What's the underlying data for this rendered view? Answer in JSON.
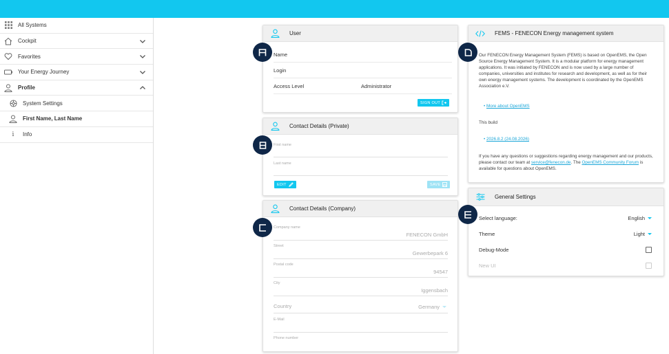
{
  "sidebar": {
    "items": [
      {
        "label": "All Systems",
        "icon": "grid-icon"
      },
      {
        "label": "Cockpit",
        "icon": "home-icon"
      },
      {
        "label": "Favorites",
        "icon": "heart-icon"
      },
      {
        "label": "Your Energy Journey",
        "icon": "battery-icon"
      },
      {
        "label": "Profile",
        "icon": "person-icon"
      },
      {
        "label": "System Settings",
        "icon": "settings-icon"
      },
      {
        "label": "First Name, Last Name",
        "icon": "person-icon"
      },
      {
        "label": "Info",
        "icon": "info-icon"
      }
    ]
  },
  "user_card": {
    "title": "User",
    "name_label": "Name",
    "login_label": "Login",
    "access_label": "Access Level",
    "access_value": "Administrator",
    "signout_label": "SIGN OUT"
  },
  "private_card": {
    "title": "Contact Details (Private)",
    "first_name_label": "First name",
    "last_name_label": "Last name",
    "edit_label": "EDIT",
    "save_label": "SAVE"
  },
  "company_card": {
    "title": "Contact Details (Company)",
    "company_name_label": "Company name",
    "company_name_value": "FENECON GmbH",
    "street_label": "Street",
    "street_value": "Gewerbepark 6",
    "postal_label": "Postal code",
    "postal_value": "94547",
    "city_label": "City",
    "city_value": "Iggensbach",
    "country_label": "Country",
    "country_value": "Germany",
    "email_label": "E-Mail",
    "phone_label": "Phone number"
  },
  "about_card": {
    "title": "FEMS - FENECON Energy management system",
    "intro": "Our FENECON Energy Management System (FEMS) is based on OpenEMS, the Open Source Energy Management System. It is a modular platform for energy management applications. It was initiated by FENECON and is now used by a large number of companies, universities and institutes for research and development, as well as for their own energy management systems. The development is coordinated by the OpenEMS Association e.V.",
    "more_link": "More about OpenEMS",
    "build_label": "This build",
    "build_version": "2026.8.2 (24.08.2026)",
    "contact_prefix": "If you have any questions or suggestions regarding energy management and our products, please contact our team at ",
    "contact_email": "service@fenecon.de",
    "contact_mid": ". The ",
    "forum_link": "OpenEMS Community Forum",
    "contact_suffix": " is available for questions about OpenEMS."
  },
  "settings_card": {
    "title": "General Settings",
    "language_label": "Select language:",
    "language_value": "English",
    "theme_label": "Theme",
    "theme_value": "Light",
    "debug_label": "Debug-Mode",
    "newui_label": "New UI"
  },
  "badges": [
    "A",
    "B",
    "C",
    "D",
    "E"
  ],
  "colors": {
    "accent": "#12c7ef",
    "badge": "#0f2748"
  }
}
